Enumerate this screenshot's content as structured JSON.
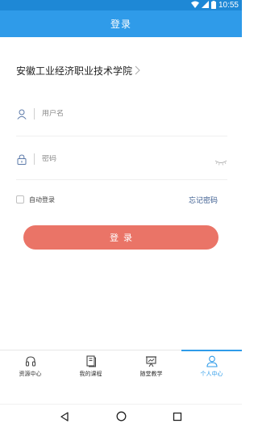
{
  "status_bar": {
    "time": "10:55",
    "icons": [
      "wifi-icon",
      "signal-icon",
      "battery-icon"
    ]
  },
  "title_bar": {
    "title": "登录"
  },
  "school": {
    "name": "安徽工业经济职业技术学院",
    "icon": "chevron-right-icon"
  },
  "form": {
    "username_placeholder": "用户名",
    "username_value": "",
    "password_placeholder": "密码",
    "password_value": "",
    "user_icon": "user-icon",
    "lock_icon": "lock-icon",
    "eye_icon": "eye-closed-icon"
  },
  "options": {
    "auto_login_label": "自动登录",
    "auto_login_checked": false,
    "forgot_password": "忘记密码"
  },
  "login_button": {
    "label": "登录"
  },
  "bottom_nav": {
    "items": [
      {
        "label": "资源中心",
        "icon": "headphones-icon"
      },
      {
        "label": "我的课程",
        "icon": "book-icon"
      },
      {
        "label": "随堂教学",
        "icon": "presentation-icon"
      },
      {
        "label": "个人中心",
        "icon": "person-icon"
      }
    ],
    "active_index": 3
  },
  "colors": {
    "title_bar": "#2f9be9",
    "status_bar": "#1e88d6",
    "login_button": "#ea7467",
    "link": "#3a5b8f",
    "active_nav": "#2f9be9"
  },
  "system_nav": {
    "icons": [
      "back-icon",
      "home-icon",
      "recents-icon"
    ]
  }
}
